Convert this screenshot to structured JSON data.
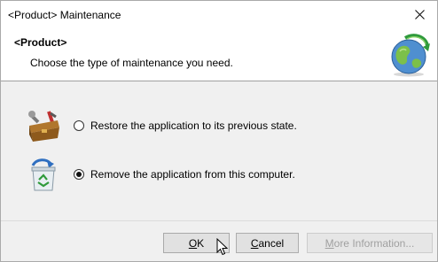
{
  "window": {
    "title": "<Product> Maintenance"
  },
  "header": {
    "title": "<Product>",
    "subtitle": "Choose the type of maintenance you need."
  },
  "options": [
    {
      "label": "Restore the application to its previous state.",
      "selected": false,
      "icon": "toolbox-repair-icon"
    },
    {
      "label": "Remove the application from this computer.",
      "selected": true,
      "icon": "recycle-bin-icon"
    }
  ],
  "buttons": {
    "ok": {
      "access": "O",
      "rest": "K"
    },
    "cancel": {
      "access": "C",
      "rest": "ancel"
    },
    "more": {
      "access": "M",
      "rest": "ore Information..."
    }
  }
}
